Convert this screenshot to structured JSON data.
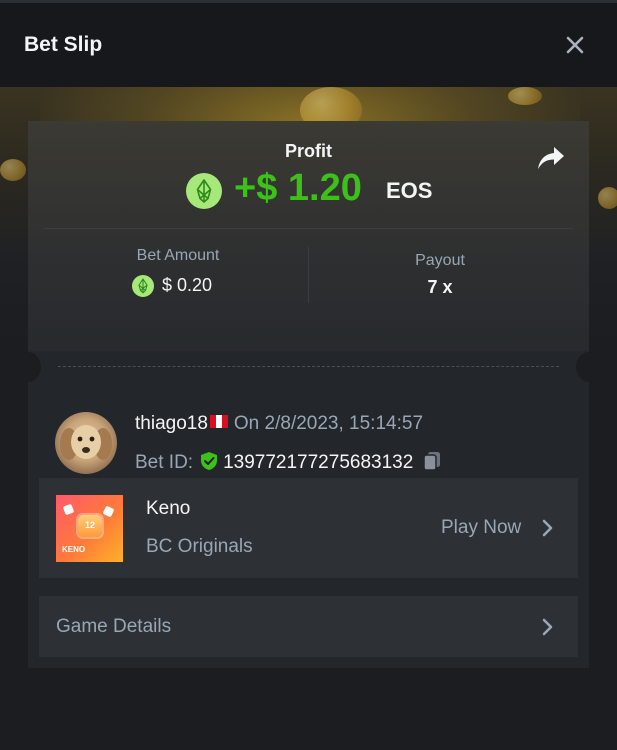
{
  "header": {
    "title": "Bet Slip",
    "close_icon": "close-icon"
  },
  "profit": {
    "label": "Profit",
    "amount": "+$ 1.20",
    "currency": "EOS",
    "currency_icon": "eos-coin-icon",
    "share_icon": "share-icon",
    "color": "#3bc117"
  },
  "stats": {
    "bet_amount_label": "Bet Amount",
    "bet_amount_value": "$ 0.20",
    "payout_label": "Payout",
    "payout_value": "7 x"
  },
  "bet": {
    "username": "thiago18",
    "flag_icon": "peru-flag-icon",
    "date": "On 2/8/2023, 15:14:57",
    "bet_id_label": "Bet ID:",
    "bet_id": "139772177275683132",
    "verified_icon": "shield-check-icon",
    "copy_icon": "copy-icon"
  },
  "game": {
    "name": "Keno",
    "provider": "BC Originals",
    "play_label": "Play Now",
    "thumb_label": "KENO",
    "thumb_number": "12"
  },
  "details": {
    "label": "Game Details"
  },
  "colors": {
    "background": "#1b1d21",
    "card": "#23262b",
    "row": "#2d3035",
    "muted_text": "#98a7b5",
    "accent_green": "#3bc117"
  }
}
